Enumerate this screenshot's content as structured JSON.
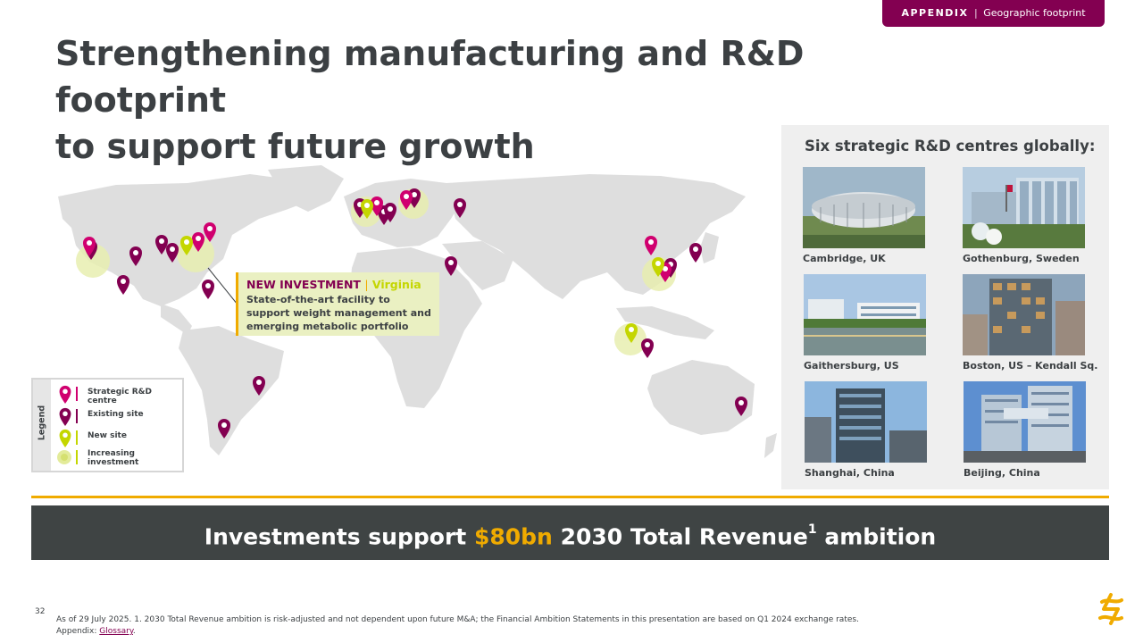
{
  "tag": {
    "section": "APPENDIX",
    "separator": "|",
    "topic": "Geographic footprint"
  },
  "title": {
    "line1": "Strengthening manufacturing and R&D footprint",
    "line2": "to support future growth"
  },
  "callout": {
    "heading": "NEW INVESTMENT",
    "separator": "|",
    "location": "Virginia",
    "body": "State-of-the-art facility to support weight management and emerging metabolic portfolio"
  },
  "legend": {
    "title": "Legend",
    "items": [
      {
        "label": "Strategic R&D centre",
        "color": "#d0006f"
      },
      {
        "label": "Existing site",
        "color": "#830051"
      },
      {
        "label": "New site",
        "color": "#c4d600"
      },
      {
        "label": "Increasing investment",
        "color": "#e3eb9a"
      }
    ]
  },
  "rd": {
    "title": "Six strategic R&D centres globally:",
    "centres": [
      {
        "label": "Cambridge, UK",
        "photo": "circular glass building"
      },
      {
        "label": "Gothenburg, Sweden",
        "photo": "glass office campus"
      },
      {
        "label": "Gaithersburg, US",
        "photo": "lakeside campus"
      },
      {
        "label": "Boston, US – Kendall Sq.",
        "photo": "glass tower"
      },
      {
        "label": "Shanghai, China",
        "photo": "modern tower"
      },
      {
        "label": "Beijing, China",
        "photo": "modern tower complex"
      }
    ]
  },
  "banner": {
    "pre": "Investments support",
    "amount": "$80bn",
    "post": "2030 Total Revenue",
    "sup": "1",
    "end": "ambition"
  },
  "footer": {
    "page": "32",
    "note": "As of 29 July 2025. 1. 2030 Total Revenue ambition is risk-adjusted and not dependent upon future M&A; the Financial Ambition Statements in this presentation are based on Q1 2024 exchange rates.",
    "appendix_label": "Appendix:",
    "link": "Glossary",
    "link_end": "."
  },
  "colors": {
    "magenta": "#d0006f",
    "mulberry": "#830051",
    "lime": "#c4d600",
    "gold": "#f0ab00",
    "dark": "#3f4444"
  },
  "icons": {
    "pin": "map-pin-icon",
    "logo": "astrazeneca-logo-icon"
  }
}
